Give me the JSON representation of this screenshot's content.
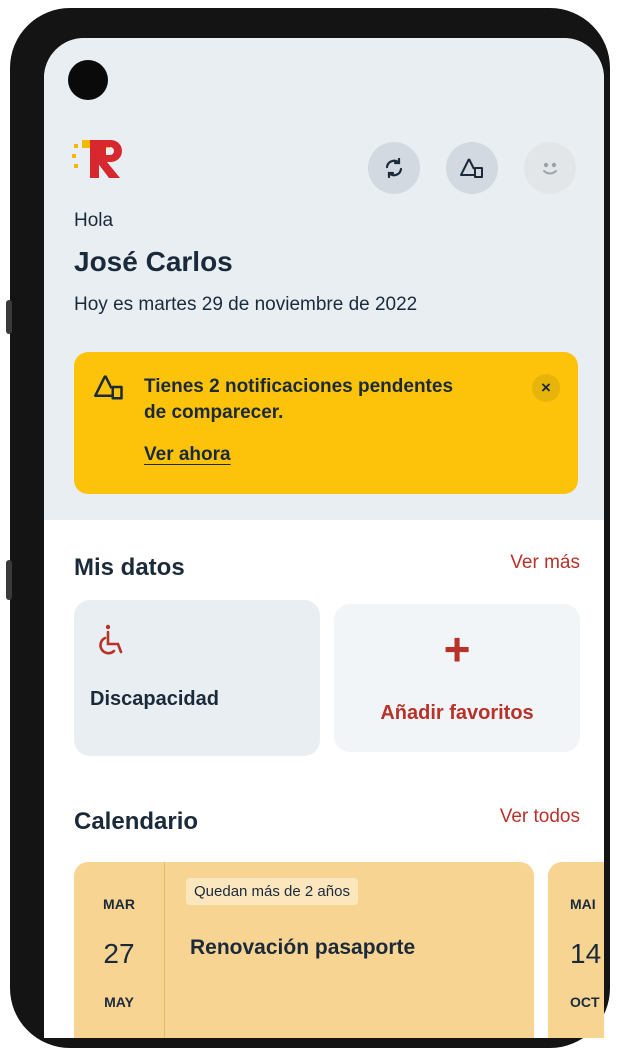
{
  "header": {
    "greeting": "Hola",
    "user_name": "José Carlos",
    "date_text": "Hoy es martes 29 de noviembre de 2022",
    "icons": [
      "refresh-icon",
      "notification-warning-icon",
      "smiley-avatar-icon"
    ]
  },
  "alert": {
    "message": "Tienes 2 notificaciones pendentes de comparecer.",
    "link": "Ver ahora",
    "close": "×"
  },
  "mis_datos": {
    "title": "Mis datos",
    "link": "Ver más",
    "cards": [
      {
        "label": "Discapacidad",
        "icon": "wheelchair-icon"
      },
      {
        "label": "Añadir favoritos",
        "icon": "plus",
        "symbol": "+"
      }
    ]
  },
  "calendario": {
    "title": "Calendario",
    "link": "Ver todos",
    "events": [
      {
        "month_start": "MAR",
        "day": "27",
        "month_end": "MAY",
        "badge": "Quedan más de 2 años",
        "title": "Renovación pasaporte"
      },
      {
        "month_start": "MAI",
        "day": "14",
        "month_end": "OCT"
      }
    ]
  },
  "colors": {
    "accent_red": "#b8322a",
    "alert_yellow": "#fcc30a",
    "text_dark": "#1b2a3a",
    "event_card": "#f8d493"
  }
}
